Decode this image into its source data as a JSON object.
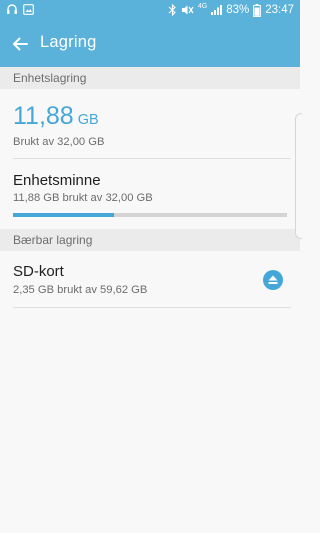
{
  "status_bar": {
    "battery": "83%",
    "time": "23:47",
    "network": "4G"
  },
  "toolbar": {
    "title": "Lagring"
  },
  "device_section": {
    "header": "Enhetslagring",
    "used_value": "11,88",
    "used_unit": "GB",
    "used_of_total": "Brukt av 32,00 GB"
  },
  "device_memory": {
    "title": "Enhetsminne",
    "detail": "11,88 GB brukt av 32,00 GB",
    "used_fraction": 0.37
  },
  "portable_section": {
    "header": "Bærbar lagring"
  },
  "sd_card": {
    "title": "SD-kort",
    "detail": "2,35 GB brukt av 59,62 GB"
  },
  "colors": {
    "accent": "#45a7d8",
    "bar": "#5ab1da"
  }
}
